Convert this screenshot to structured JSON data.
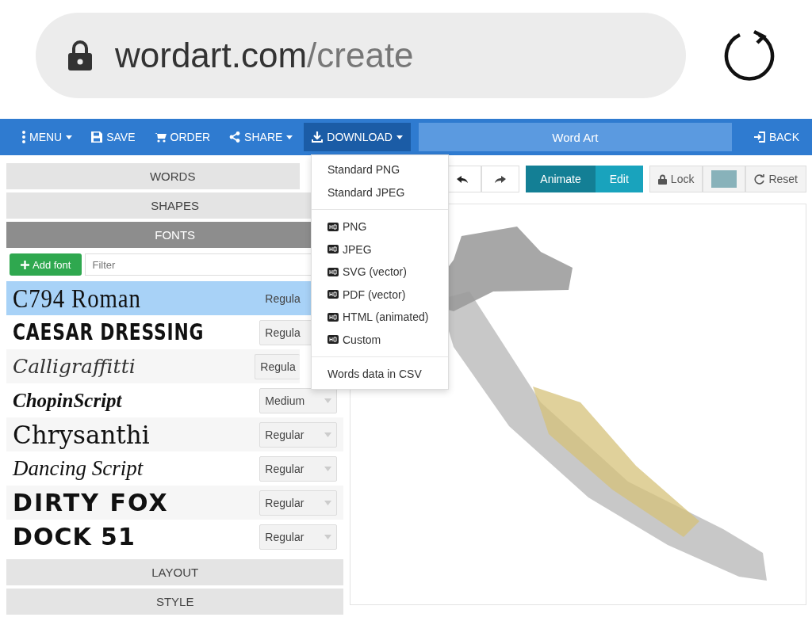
{
  "address_bar": {
    "host": "wordart.com",
    "path": "/create"
  },
  "navbar": {
    "items": [
      {
        "label": "MENU",
        "caret": true,
        "open": false
      },
      {
        "label": "SAVE",
        "caret": false,
        "open": false
      },
      {
        "label": "ORDER",
        "caret": false,
        "open": false
      },
      {
        "label": "SHARE",
        "caret": true,
        "open": false
      },
      {
        "label": "DOWNLOAD",
        "caret": true,
        "open": true
      }
    ],
    "title_field": "Word Art",
    "back": "BACK"
  },
  "download_menu": {
    "groups": [
      [
        {
          "label": "Standard PNG",
          "kind": "standard"
        },
        {
          "label": "Standard JPEG",
          "kind": "standard"
        }
      ],
      [
        {
          "label": "PNG",
          "kind": "hq"
        },
        {
          "label": "JPEG",
          "kind": "hq"
        },
        {
          "label": "SVG (vector)",
          "kind": "hq"
        },
        {
          "label": "PDF (vector)",
          "kind": "hq"
        },
        {
          "label": "HTML (animated)",
          "kind": "hq"
        },
        {
          "label": "Custom",
          "kind": "hq"
        }
      ],
      [
        {
          "label": "Words data in CSV",
          "kind": "standard"
        }
      ]
    ]
  },
  "sections_top": [
    {
      "label": "WORDS",
      "expanded": false
    },
    {
      "label": "SHAPES",
      "expanded": false
    },
    {
      "label": "FONTS",
      "expanded": true
    }
  ],
  "fonts": {
    "add_button": "Add font",
    "filter_placeholder": "Filter",
    "rows": [
      {
        "name": "C794 Roman",
        "weight": "Regula",
        "selected": true
      },
      {
        "name": "CAESAR DRESSING",
        "weight": "Regula",
        "selected": false
      },
      {
        "name": "Calligraffitti",
        "weight": "Regula",
        "selected": false
      },
      {
        "name": "ChopinScript",
        "weight": "Medium",
        "selected": false
      },
      {
        "name": "Chrysanthi",
        "weight": "Regular",
        "selected": false
      },
      {
        "name": "Dancing Script",
        "weight": "Regular",
        "selected": false
      },
      {
        "name": "DIRTY FOX",
        "weight": "Regular",
        "selected": false
      },
      {
        "name": "DOCK 51",
        "weight": "Regular",
        "selected": false
      }
    ]
  },
  "sections_bottom": [
    {
      "label": "LAYOUT",
      "expanded": false
    },
    {
      "label": "STYLE",
      "expanded": false
    }
  ],
  "toolbar": {
    "modes": [
      {
        "label": "Animate",
        "selected": true
      },
      {
        "label": "Edit",
        "selected": false
      }
    ],
    "lock": "Lock",
    "reset": "Reset"
  }
}
